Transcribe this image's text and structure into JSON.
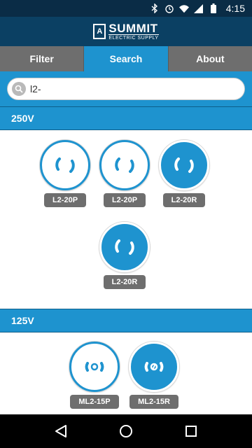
{
  "status": {
    "time": "4:15"
  },
  "header": {
    "logo_main": "SUMMIT",
    "logo_sub": "ELECTRIC SUPPLY",
    "logo_mark": "A"
  },
  "tabs": [
    {
      "label": "Filter",
      "active": false
    },
    {
      "label": "Search",
      "active": true
    },
    {
      "label": "About",
      "active": false
    }
  ],
  "search": {
    "value": "l2-",
    "placeholder": ""
  },
  "sections": [
    {
      "title": "250V",
      "items": [
        {
          "label": "L2-20P",
          "type": "plug"
        },
        {
          "label": "L2-20P",
          "type": "plug"
        },
        {
          "label": "L2-20R",
          "type": "receptacle"
        },
        {
          "label": "L2-20R",
          "type": "receptacle"
        }
      ]
    },
    {
      "title": "125V",
      "items": [
        {
          "label": "ML2-15P",
          "type": "plug"
        },
        {
          "label": "ML2-15R",
          "type": "receptacle"
        }
      ]
    }
  ],
  "colors": {
    "accent": "#1e93cf",
    "header": "#0b4063",
    "tab_inactive": "#6e6e6e",
    "label_bg": "#6e6e6e"
  },
  "icons": {
    "nav": [
      "back-icon",
      "home-icon",
      "recents-icon"
    ]
  }
}
